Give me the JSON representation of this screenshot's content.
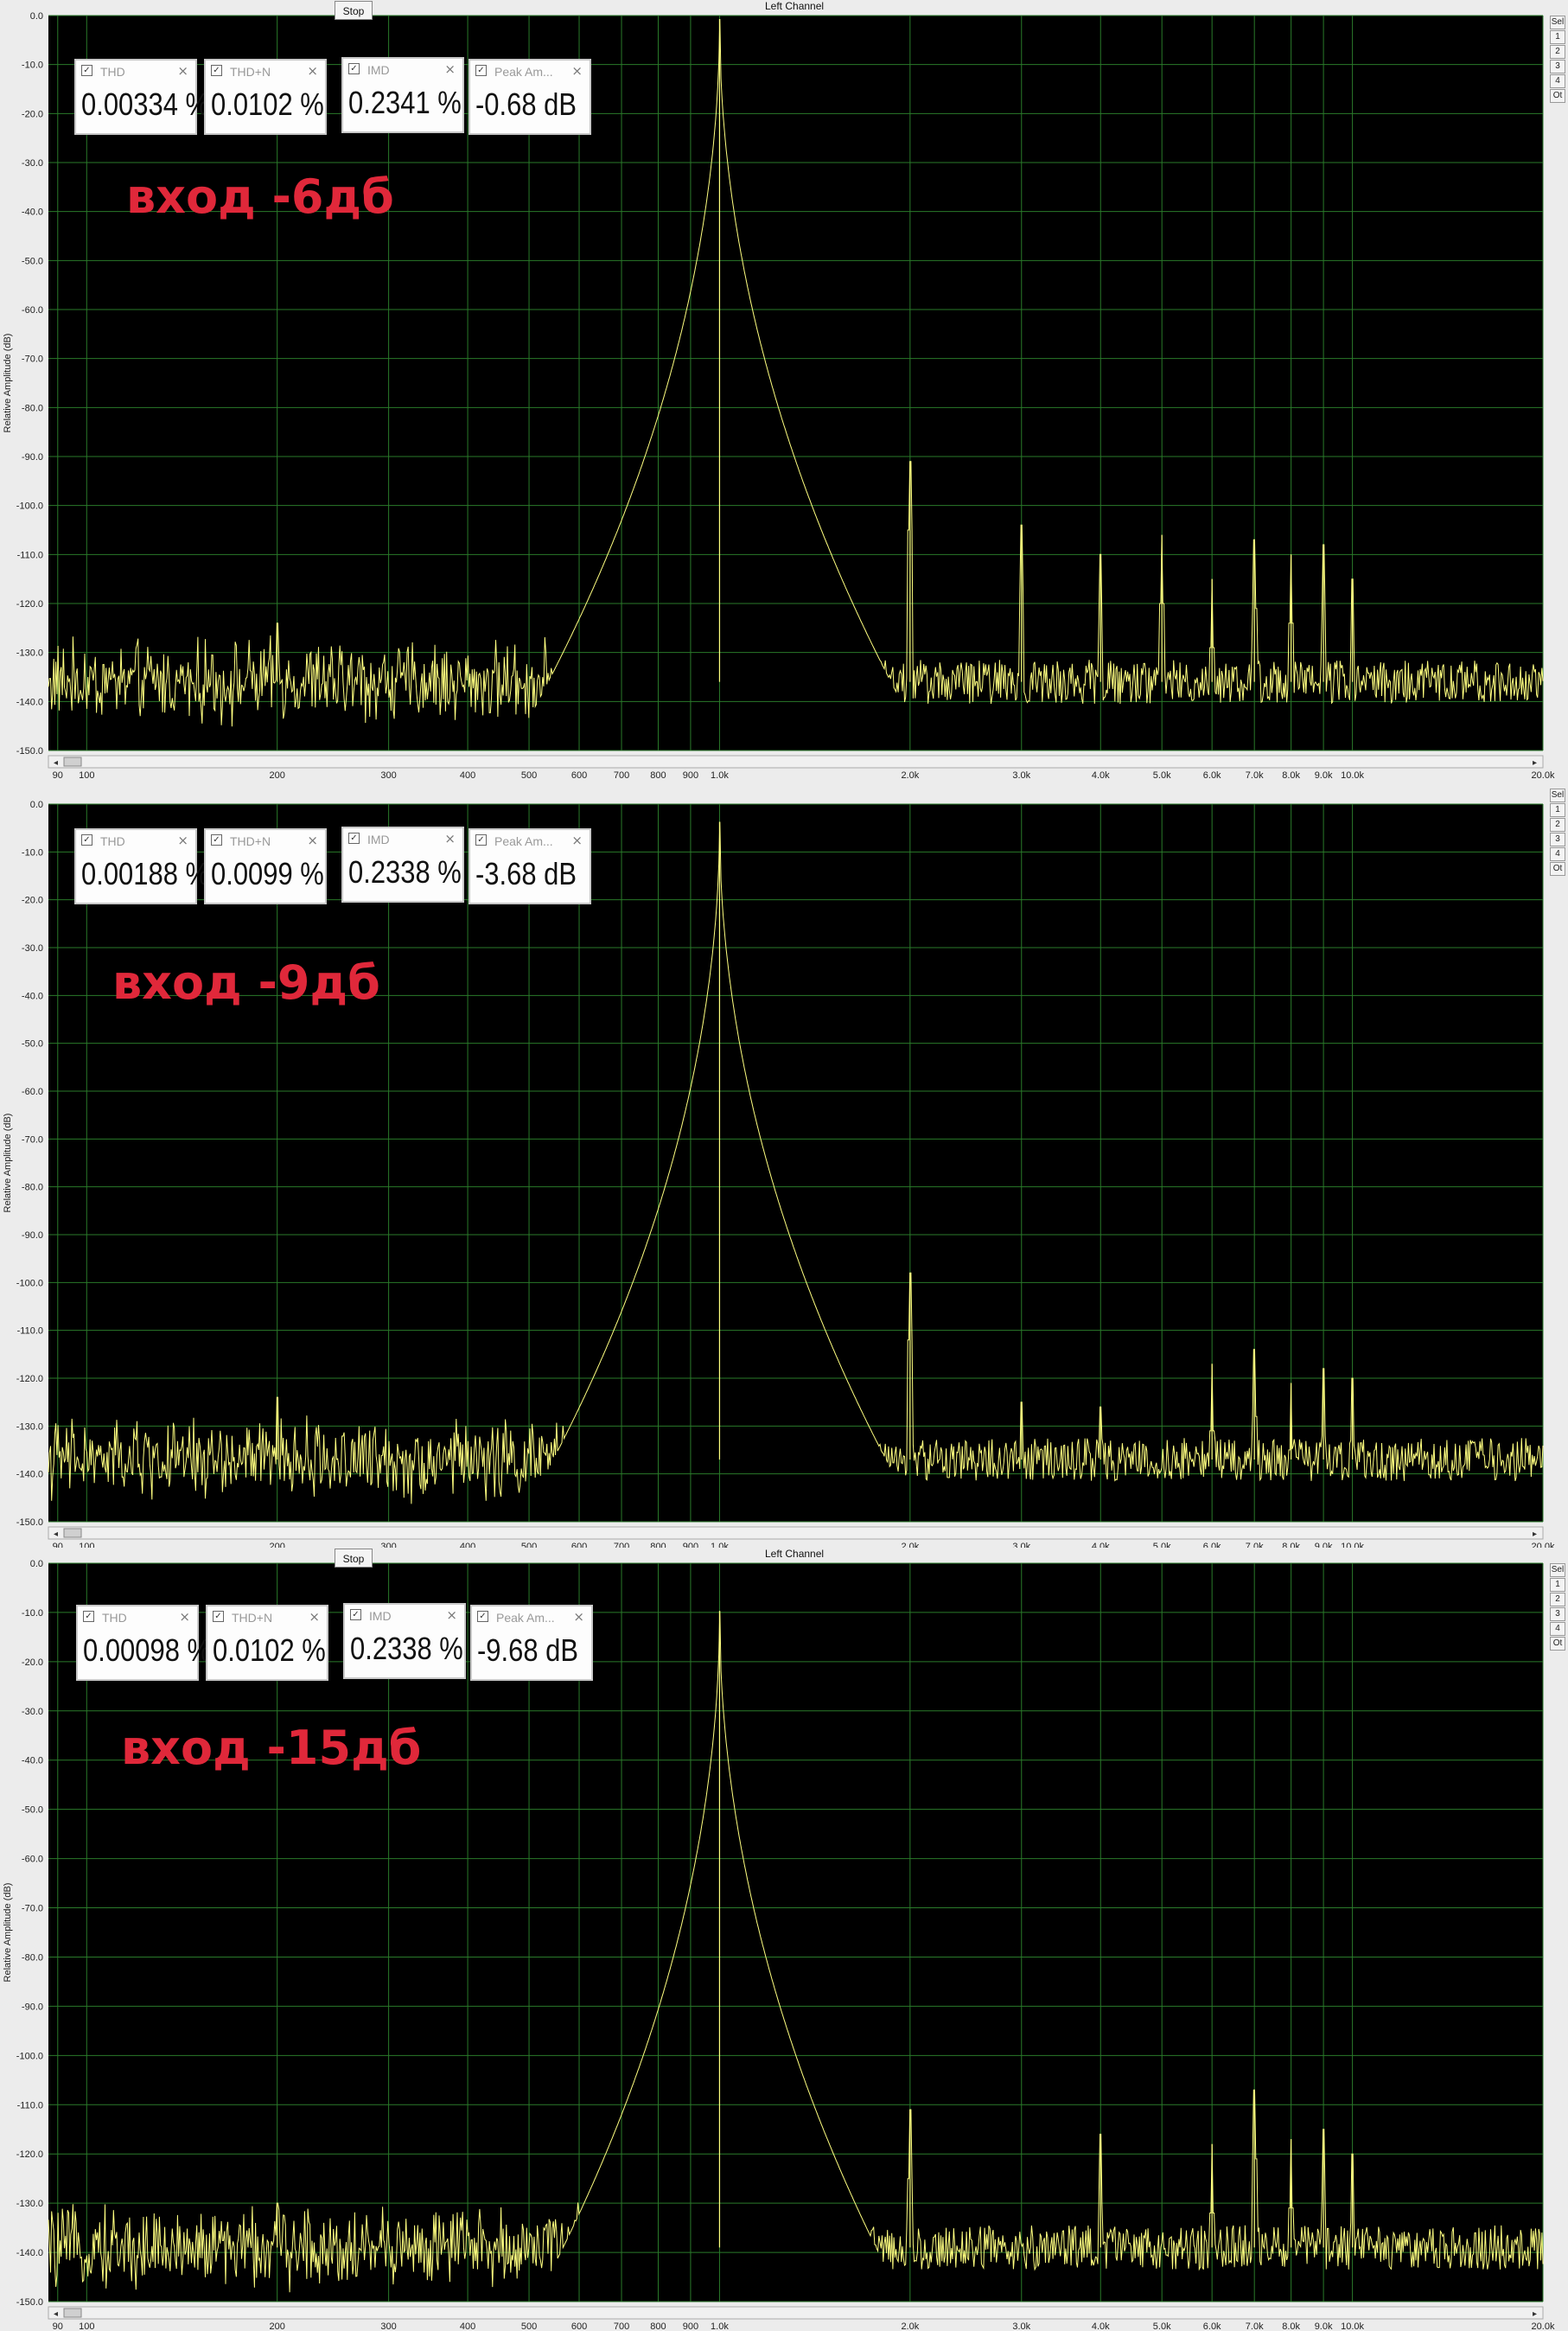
{
  "window": {
    "channel_title": "Left Channel",
    "stop_label": "Stop",
    "side_tabs": [
      "Sel",
      "1",
      "2",
      "3",
      "4",
      "Ot"
    ]
  },
  "colors": {
    "plot_bg": "#000000",
    "grid": "#2a7a2a",
    "trace": "#ffff80",
    "label_red": "#e0283a",
    "scroll_bg": "#f0f0f0"
  },
  "axis_label": "Relative Amplitude (dB)",
  "chart_data": [
    {
      "type": "line",
      "overlay_label": "вход -6дб",
      "ylabel": "Relative Amplitude (dB)",
      "xscale": "log",
      "xlim": [
        87,
        20000
      ],
      "ylim": [
        -150,
        0
      ],
      "grid": true,
      "meters": [
        {
          "name": "THD",
          "value": "0.00334 %"
        },
        {
          "name": "THD+N",
          "value": "0.0102 %"
        },
        {
          "name": "IMD",
          "value": "0.2341 %"
        },
        {
          "name": "Peak Am...",
          "value": "-0.68 dB"
        }
      ],
      "noise_floor": -136,
      "peaks": [
        {
          "x": 1000,
          "y": -0.7
        },
        {
          "x": 2000,
          "y": -91
        },
        {
          "x": 3000,
          "y": -104
        },
        {
          "x": 4000,
          "y": -110
        },
        {
          "x": 5000,
          "y": -106
        },
        {
          "x": 6000,
          "y": -115
        },
        {
          "x": 7000,
          "y": -107
        },
        {
          "x": 8000,
          "y": -110
        },
        {
          "x": 9000,
          "y": -108
        },
        {
          "x": 10000,
          "y": -115
        },
        {
          "x": 200,
          "y": -124
        }
      ]
    },
    {
      "type": "line",
      "overlay_label": "вход -9дб",
      "ylabel": "Relative Amplitude (dB)",
      "xscale": "log",
      "xlim": [
        87,
        20000
      ],
      "ylim": [
        -150,
        0
      ],
      "grid": true,
      "meters": [
        {
          "name": "THD",
          "value": "0.00188 %"
        },
        {
          "name": "THD+N",
          "value": "0.0099 %"
        },
        {
          "name": "IMD",
          "value": "0.2338 %"
        },
        {
          "name": "Peak Am...",
          "value": "-3.68 dB"
        }
      ],
      "noise_floor": -137,
      "peaks": [
        {
          "x": 1000,
          "y": -3.7
        },
        {
          "x": 2000,
          "y": -98
        },
        {
          "x": 3000,
          "y": -125
        },
        {
          "x": 4000,
          "y": -126
        },
        {
          "x": 6000,
          "y": -117
        },
        {
          "x": 7000,
          "y": -114
        },
        {
          "x": 8000,
          "y": -121
        },
        {
          "x": 9000,
          "y": -118
        },
        {
          "x": 10000,
          "y": -120
        },
        {
          "x": 200,
          "y": -124
        }
      ]
    },
    {
      "type": "line",
      "overlay_label": "вход -15дб",
      "ylabel": "Relative Amplitude (dB)",
      "xscale": "log",
      "xlim": [
        87,
        20000
      ],
      "ylim": [
        -150,
        0
      ],
      "grid": true,
      "meters": [
        {
          "name": "THD",
          "value": "0.00098 %"
        },
        {
          "name": "THD+N",
          "value": "0.0102 %"
        },
        {
          "name": "IMD",
          "value": "0.2338 %"
        },
        {
          "name": "Peak Am...",
          "value": "-9.68 dB"
        }
      ],
      "noise_floor": -139,
      "peaks": [
        {
          "x": 1000,
          "y": -9.7
        },
        {
          "x": 2000,
          "y": -111
        },
        {
          "x": 4000,
          "y": -116
        },
        {
          "x": 6000,
          "y": -118
        },
        {
          "x": 7000,
          "y": -107
        },
        {
          "x": 8000,
          "y": -117
        },
        {
          "x": 9000,
          "y": -115
        },
        {
          "x": 10000,
          "y": -120
        },
        {
          "x": 200,
          "y": -130
        }
      ]
    }
  ],
  "yticks": [
    "0.0",
    "-10.0",
    "-20.0",
    "-30.0",
    "-40.0",
    "-50.0",
    "-60.0",
    "-70.0",
    "-80.0",
    "-90.0",
    "-100.0",
    "-110.0",
    "-120.0",
    "-130.0",
    "-140.0",
    "-150.0"
  ],
  "xticks": [
    {
      "v": 90,
      "label": "90"
    },
    {
      "v": 100,
      "label": "100"
    },
    {
      "v": 200,
      "label": "200"
    },
    {
      "v": 300,
      "label": "300"
    },
    {
      "v": 400,
      "label": "400"
    },
    {
      "v": 500,
      "label": "500"
    },
    {
      "v": 600,
      "label": "600"
    },
    {
      "v": 700,
      "label": "700"
    },
    {
      "v": 800,
      "label": "800"
    },
    {
      "v": 900,
      "label": "900"
    },
    {
      "v": 1000,
      "label": "1.0k"
    },
    {
      "v": 2000,
      "label": "2.0k"
    },
    {
      "v": 3000,
      "label": "3.0k"
    },
    {
      "v": 4000,
      "label": "4.0k"
    },
    {
      "v": 5000,
      "label": "5.0k"
    },
    {
      "v": 6000,
      "label": "6.0k"
    },
    {
      "v": 7000,
      "label": "7.0k"
    },
    {
      "v": 8000,
      "label": "8.0k"
    },
    {
      "v": 9000,
      "label": "9.0k"
    },
    {
      "v": 10000,
      "label": "10.0k"
    },
    {
      "v": 20000,
      "label": "20.0k"
    }
  ]
}
